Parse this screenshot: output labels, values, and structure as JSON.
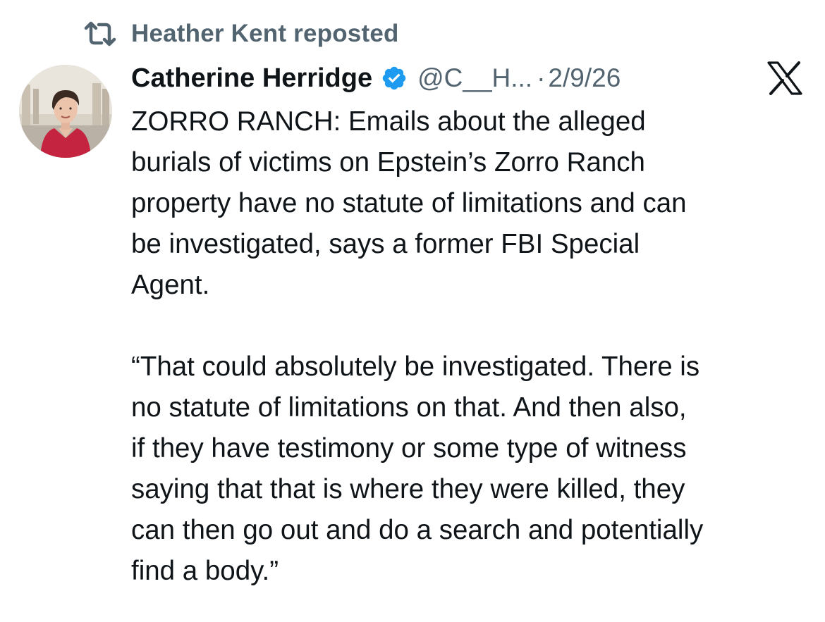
{
  "repost": {
    "icon": "repost-icon",
    "label": "Heather Kent reposted"
  },
  "author": {
    "avatar": "avatar",
    "name": "Catherine Herridge",
    "verified_icon": "verified-badge-icon",
    "handle": "@C__H...",
    "separator": "·",
    "date": "2/9/26"
  },
  "platform_logo": "x-logo-icon",
  "tweet": {
    "paragraph1": "ZORRO RANCH: Emails about the alleged\nburials of victims on Epstein’s Zorro Ranch\nproperty have no statute of limitations and can\nbe investigated, says a former FBI Special\nAgent.",
    "paragraph2": "“That could absolutely be investigated. There is\nno statute of limitations on that. And then also,\nif they have testimony or some type of witness\nsaying that that is where they were killed, they\ncan then go out and do a search and potentially\nfind a body.”"
  },
  "colors": {
    "text_primary": "#0f1419",
    "text_secondary": "#536471",
    "verified_blue": "#1d9bf0",
    "background": "#ffffff"
  }
}
